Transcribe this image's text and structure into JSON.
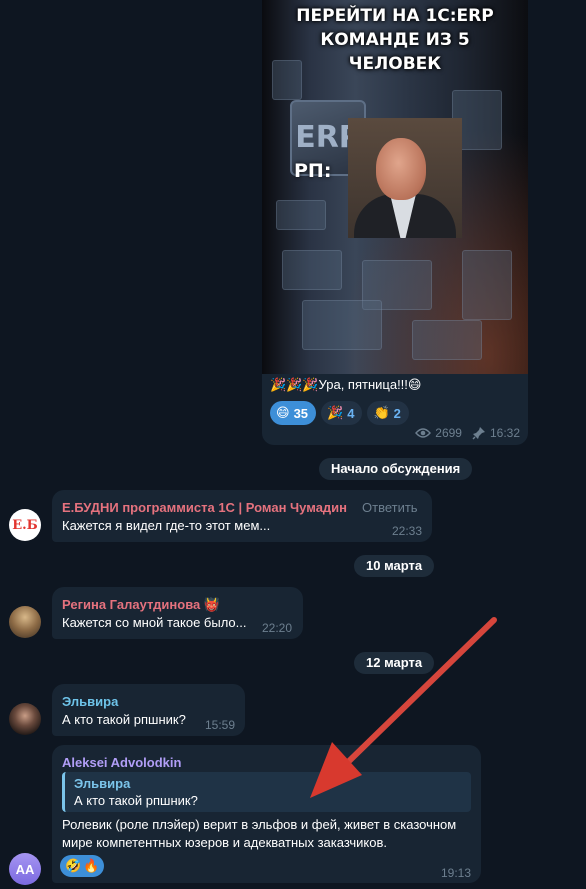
{
  "post": {
    "meme_caption": "ПЕРЕЙТИ НА 1С:ERP\nКОМАНДЕ ИЗ 5\nЧЕЛОВЕК",
    "meme_plate": "ERP",
    "meme_rp_label": "РП:",
    "text": "🎉🎉🎉Ура, пятница!!!😄",
    "reactions": [
      {
        "emoji": "😄",
        "count": "35",
        "active": true
      },
      {
        "emoji": "🎉",
        "count": "4",
        "active": false
      },
      {
        "emoji": "👏",
        "count": "2",
        "active": false
      }
    ],
    "views": "2699",
    "time": "16:32"
  },
  "discussion_start_label": "Начало обсуждения",
  "messages": [
    {
      "sender": "Е.БУДНИ программиста 1С | Роман Чумадин",
      "reply_action": "Ответить",
      "text": "Кажется я видел где-то этот мем...",
      "time": "22:33",
      "avatar_text": "Е.Б"
    },
    {
      "sender": "Регина Галаутдинова",
      "sender_badge": "👹",
      "text": "Кажется со мной такое было...",
      "time": "22:20"
    },
    {
      "sender": "Эльвира",
      "text": "А кто такой рпшник?",
      "time": "15:59"
    },
    {
      "sender": "Aleksei Advolodkin",
      "quote": {
        "sender": "Эльвира",
        "text": "А кто такой рпшник?"
      },
      "text_line1": "Ролевик (роле плэйер) верит в эльфов и фей, живет в сказочном",
      "text_line2": "мире компетентных юзеров и адекватных заказчиков.",
      "time": "19:13",
      "avatar_text": "AA",
      "reactions": [
        "🤣",
        "🔥"
      ]
    }
  ],
  "date_separators": [
    "10 марта",
    "12 марта"
  ],
  "colors": {
    "background": "#0e1621",
    "bubble": "#182533",
    "accent_blue": "#3d8fd8",
    "sender_red": "#e5727e",
    "sender_cyan": "#6ec3e9",
    "sender_violet": "#b19ef7",
    "arrow": "#e04a3f"
  },
  "icons": [
    "eye-icon",
    "pin-icon",
    "arrow-annotation"
  ]
}
